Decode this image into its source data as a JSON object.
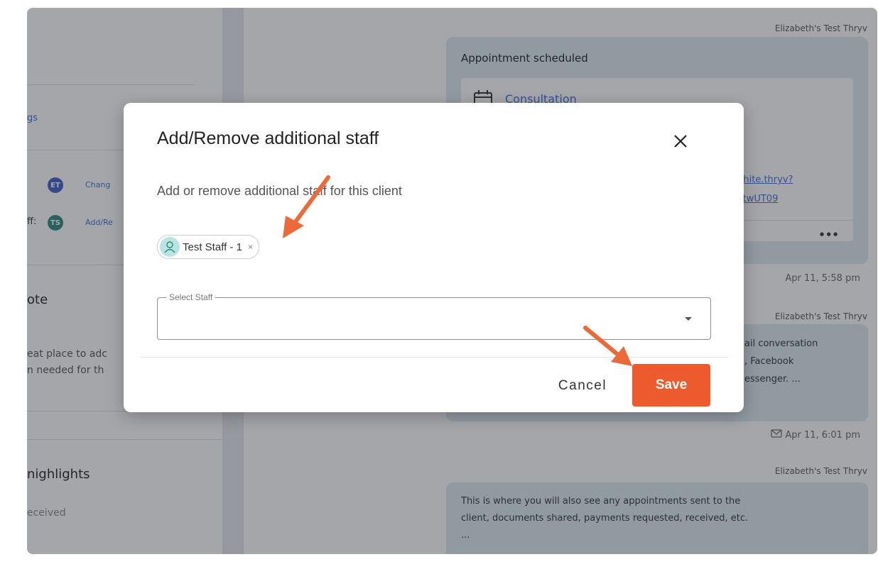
{
  "left_panel": {
    "settings_link_partial": "gs",
    "assigned_staff_avatar": "ET",
    "change_link_partial": "Chang",
    "additional_staff_prefix": "ff:",
    "additional_staff_avatar": "TS",
    "add_remove_link_partial": "Add/Re",
    "note_heading_partial": "ote",
    "note_text_line1": "eat place to adc",
    "note_text_line2": "n needed for th",
    "highlights_heading_partial": "nighlights",
    "received_partial": "eceived"
  },
  "conversation": {
    "msg1": {
      "sender": "Elizabeth's Test Thryv",
      "title": "Appointment scheduled",
      "service": "Consultation",
      "link_line1": "/hite.thryv?",
      "link_line2": "itwUT09",
      "more": "•••",
      "time": "Apr 11, 5:58 pm"
    },
    "msg2": {
      "sender": "Elizabeth's Test Thryv",
      "line1": "ail conversation",
      "line2": ", Facebook",
      "line3": "essenger. ...",
      "time": "Apr 11, 6:01 pm"
    },
    "msg3": {
      "sender": "Elizabeth's Test Thryv",
      "line1": "This is where you will also see any appointments sent to the",
      "line2": "client, documents shared, payments requested, received, etc.",
      "line3": "..."
    }
  },
  "dialog": {
    "title": "Add/Remove additional staff",
    "subtitle": "Add or remove additional staff for this client",
    "chip_label": "Test Staff - 1",
    "chip_remove": "×",
    "select_label": "Select Staff",
    "cancel_label": "Cancel",
    "save_label": "Save"
  },
  "colors": {
    "accent": "#ec5a2e",
    "link": "#3d6bd6",
    "avatar_et": "#3d5fc4",
    "avatar_ts": "#2a8a7a",
    "bubble": "#dde8f0"
  }
}
